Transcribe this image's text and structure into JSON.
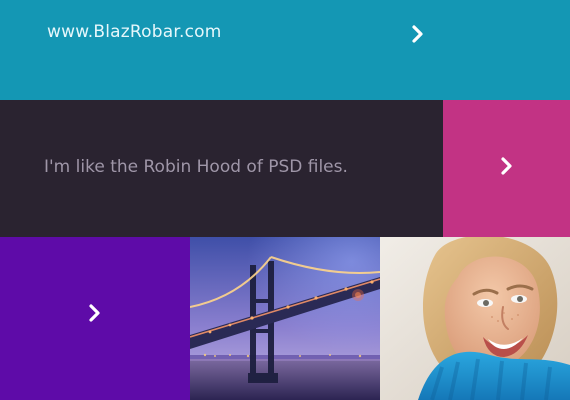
{
  "banner": {
    "link_text": "www.BlazRobar.com",
    "arrow_icon": "chevron-right-icon",
    "color": "#1497b4"
  },
  "quote": {
    "text": "I'm like the Robin Hood of PSD files.",
    "color": "#2a2330"
  },
  "tiles": {
    "magenta": {
      "arrow_icon": "chevron-right-icon",
      "color": "#c23384"
    },
    "purple": {
      "arrow_icon": "chevron-right-icon",
      "color": "#5e0ba8"
    },
    "bridge_photo": {
      "label": "bridge-photo"
    },
    "portrait_photo": {
      "label": "smiling-woman-photo"
    }
  }
}
